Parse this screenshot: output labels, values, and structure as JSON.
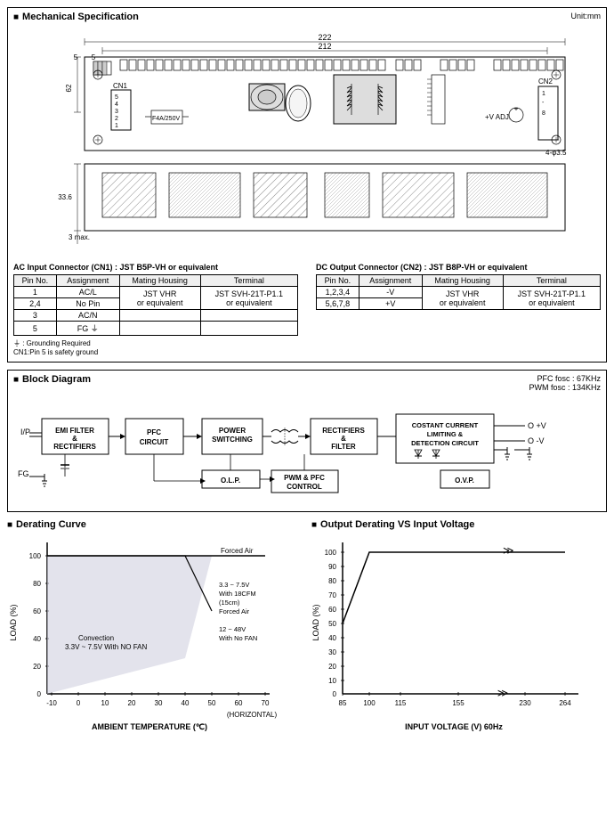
{
  "mechanical": {
    "title": "Mechanical Specification",
    "unit": "Unit:mm",
    "drawing": {
      "dim_222": "222",
      "dim_212": "212",
      "dim_62": "62",
      "dim_33_6": "33.6",
      "dim_5": "5",
      "dim_3max": "3 max.",
      "fuse": "F4A/250V",
      "vadj": "+V ADJ.",
      "cn1": "CN1",
      "cn2": "CN2",
      "hole_note": "4-φ3.5"
    },
    "ac_connector": {
      "title": "AC Input Connector (CN1) : JST B5P-VH or equivalent",
      "columns": [
        "Pin No.",
        "Assignment",
        "Mating Housing",
        "Terminal"
      ],
      "rows": [
        [
          "1",
          "AC/L",
          "",
          ""
        ],
        [
          "2,4",
          "No Pin",
          "JST VHR",
          "JST SVH-21T-P1.1"
        ],
        [
          "3",
          "AC/N",
          "or equivalent",
          "or equivalent"
        ],
        [
          "5",
          "FG ⏚",
          "",
          ""
        ]
      ],
      "note1": "⏚ : Grounding Required",
      "note2": "CN1:Pin 5 is safety ground"
    },
    "dc_connector": {
      "title": "DC Output Connector (CN2) : JST B8P-VH or equivalent",
      "columns": [
        "Pin No.",
        "Assignment",
        "Mating Housing",
        "Terminal"
      ],
      "rows": [
        [
          "1,2,3,4",
          "-V",
          "JST VHR",
          "JST SVH-21T-P1.1"
        ],
        [
          "5,6,7,8",
          "+V",
          "or equivalent",
          "or equivalent"
        ]
      ]
    }
  },
  "block_diagram": {
    "title": "Block Diagram",
    "pfc_fosc": "PFC fosc : 67KHz",
    "pwm_fosc": "PWM fosc : 134KHz",
    "ip_label": "I/P",
    "fg_label": "FG",
    "vplus_label": "O +V",
    "vminus_label": "O -V",
    "blocks": [
      {
        "id": "emi",
        "label": "EMI FILTER\n& \nRECTIFIERS"
      },
      {
        "id": "pfc",
        "label": "PFC\nCIRCUIT"
      },
      {
        "id": "pwr",
        "label": "POWER\nSWITCHING"
      },
      {
        "id": "rect",
        "label": "RECTIFIERS\n&\nFILTER"
      },
      {
        "id": "olp",
        "label": "O.L.P."
      },
      {
        "id": "pwm",
        "label": "PWM & PFC\nCONTROL"
      },
      {
        "id": "cc",
        "label": "COSTANT CURRENT\nLIMITING &\nDETECTION CIRCUIT"
      },
      {
        "id": "ovp",
        "label": "O.V.P."
      }
    ]
  },
  "derating": {
    "title": "Derating Curve",
    "y_label": "LOAD (%)",
    "x_label": "AMBIENT TEMPERATURE (℃)",
    "y_ticks": [
      "0",
      "20",
      "40",
      "60",
      "80",
      "100"
    ],
    "x_ticks": [
      "-10",
      "0",
      "10",
      "20",
      "30",
      "40",
      "50",
      "60",
      "70"
    ],
    "x_extra": "(HORIZONTAL)",
    "annotations": [
      "Forced Air",
      "3.3 ~ 7.5V\nWith 18CFM\n(15cm)\nForced Air",
      "12 ~ 48V\nWith No FAN",
      "Convection\n3.3V ~ 7.5V With NO FAN"
    ]
  },
  "output_derating": {
    "title": "Output Derating VS Input Voltage",
    "y_label": "LOAD (%)",
    "x_label": "INPUT VOLTAGE (V) 60Hz",
    "y_ticks": [
      "0",
      "10",
      "20",
      "30",
      "40",
      "50",
      "60",
      "70",
      "80",
      "90",
      "100"
    ],
    "x_ticks": [
      "85",
      "100",
      "115",
      "155",
      "230",
      "264"
    ]
  }
}
